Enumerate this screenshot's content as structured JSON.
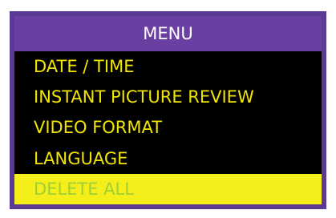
{
  "menu": {
    "title": "MENU",
    "items": [
      {
        "label": "DATE / TIME",
        "selected": false
      },
      {
        "label": "INSTANT PICTURE REVIEW",
        "selected": false
      },
      {
        "label": "VIDEO FORMAT",
        "selected": false
      },
      {
        "label": "LANGUAGE",
        "selected": false
      },
      {
        "label": "DELETE ALL",
        "selected": true
      }
    ]
  },
  "colors": {
    "frame": "#5b3a94",
    "header_background": "#6a3fa2",
    "screen_background": "#000000",
    "item_text": "#f2e600",
    "selected_background": "#f4ef1a",
    "selected_text": "#9fcf36"
  }
}
